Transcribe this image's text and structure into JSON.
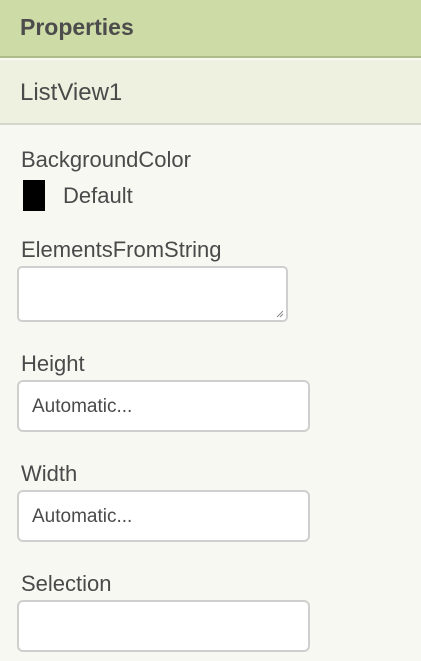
{
  "header": {
    "title": "Properties"
  },
  "component": {
    "name": "ListView1"
  },
  "properties": {
    "background_color": {
      "label": "BackgroundColor",
      "value": "Default",
      "swatch_color": "#000000"
    },
    "elements_from_string": {
      "label": "ElementsFromString",
      "value": ""
    },
    "height": {
      "label": "Height",
      "value": "Automatic..."
    },
    "width": {
      "label": "Width",
      "value": "Automatic..."
    },
    "selection": {
      "label": "Selection",
      "value": ""
    }
  }
}
